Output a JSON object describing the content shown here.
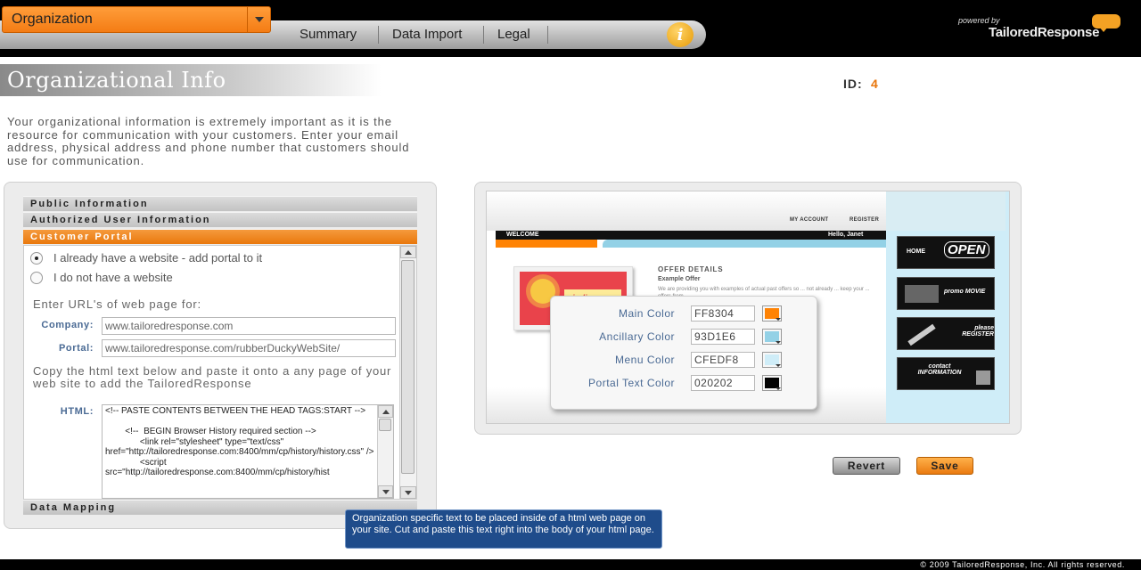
{
  "header": {
    "org_select": "Organization",
    "nav": [
      "Summary",
      "Data Import",
      "Legal"
    ],
    "info_icon": "i",
    "logo_powered_by": "powered by",
    "logo_brand": "TailoredResponse"
  },
  "page": {
    "title": "Organizational Info",
    "id_label": "ID:",
    "id_value": "4",
    "intro": "Your organizational information is extremely important as it is the resource for communication with your customers. Enter your email address, physical address and phone number that customers should use for communication."
  },
  "accordion": {
    "sections": [
      "Public Information",
      "Authorized User Information",
      "Customer Portal",
      "Data Mapping"
    ],
    "active": "Customer Portal"
  },
  "portal": {
    "radio_existing": "I already have a website - add portal to it",
    "radio_none": "I do not have a website",
    "selected_radio": "existing",
    "url_heading": "Enter URL's of web page for:",
    "company_label": "Company:",
    "company_value": "www.tailoredresponse.com",
    "portal_label": "Portal:",
    "portal_value": "www.tailoredresponse.com/rubberDuckyWebSite/",
    "copy_instructions": "Copy the html text below and paste it onto a any page of your web site to add the TailoredResponse",
    "html_label": "HTML:",
    "html_value": "<!-- PASTE CONTENTS BETWEEN THE HEAD TAGS:START -->\n\n        <!--  BEGIN Browser History required section -->\n              <link rel=\"stylesheet\" type=\"text/css\" href=\"http://tailoredresponse.com:8400/mm/cp/history/history.css\" />\n              <script src=\"http://tailoredresponse.com:8400/mm/cp/history/hist"
  },
  "preview": {
    "my_account": "MY ACCOUNT",
    "register": "REGISTER",
    "welcome": "WELCOME",
    "hello": "Hello, Janet",
    "offer_title": "OFFER DETAILS",
    "offer_sub": "Example Offer",
    "offer_body": "We are providing you with examples of actual past offers so ... not already ... keep your ... offers from",
    "sizzling": "sizzling",
    "tiles": [
      "HOME",
      "OPEN",
      "promo MOVIE",
      "please REGISTER",
      "contact INFORMATION"
    ]
  },
  "colors": [
    {
      "label": "Main Color",
      "value": "FF8304",
      "hex": "#FF8304"
    },
    {
      "label": "Ancillary Color",
      "value": "93D1E6",
      "hex": "#93D1E6"
    },
    {
      "label": "Menu Color",
      "value": "CFEDF8",
      "hex": "#CFEDF8"
    },
    {
      "label": "Portal Text Color",
      "value": "020202",
      "hex": "#020202"
    }
  ],
  "buttons": {
    "revert": "Revert",
    "save": "Save"
  },
  "tooltip": "Organization specific text to be placed inside of a html web page on your site. Cut and paste this text right into the body of your html page.",
  "footer": {
    "copyright": "© 2009 TailoredResponse, Inc. All rights reserved."
  }
}
